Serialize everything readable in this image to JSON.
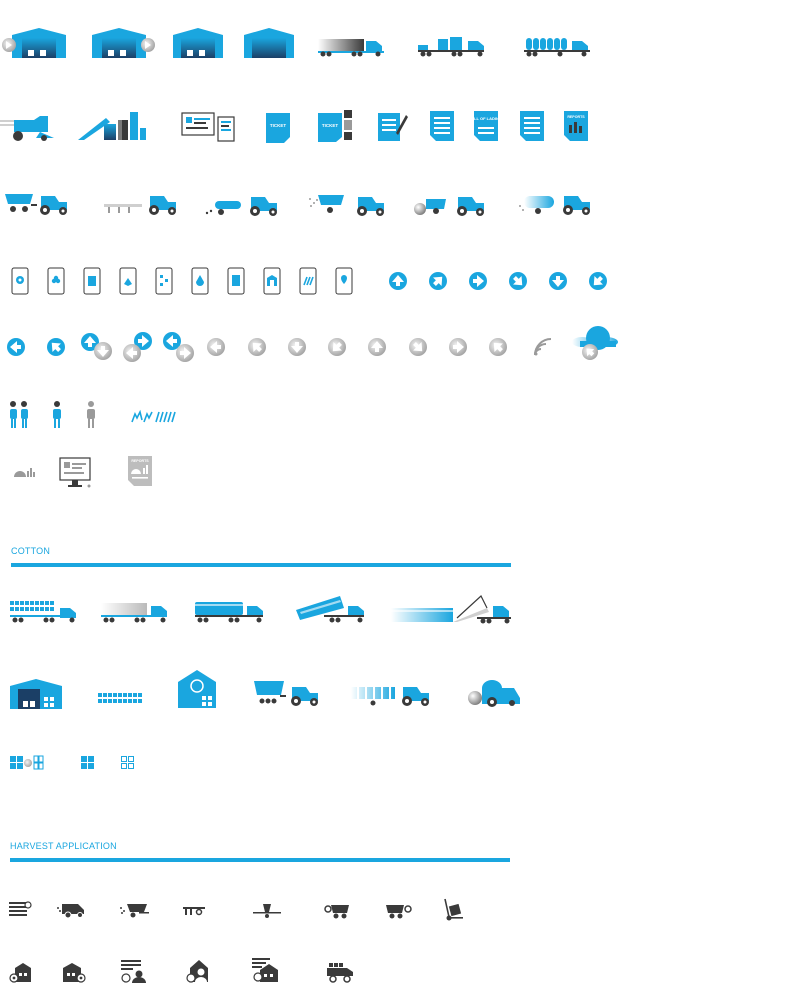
{
  "colors": {
    "accent": "#1aa6df",
    "dark": "#3a3a3a",
    "gray": "#bdbdbd",
    "white": "#ffffff"
  },
  "sections": {
    "cotton": {
      "title": "COTTON"
    },
    "harvest": {
      "title": "HARVEST APPLICATION"
    }
  },
  "labels": {
    "ticket": "TICKET",
    "bill_of_lading": "BILL OF LADING",
    "delivery_report": "DELIVERY REPORT",
    "reports": "REPORTS"
  }
}
